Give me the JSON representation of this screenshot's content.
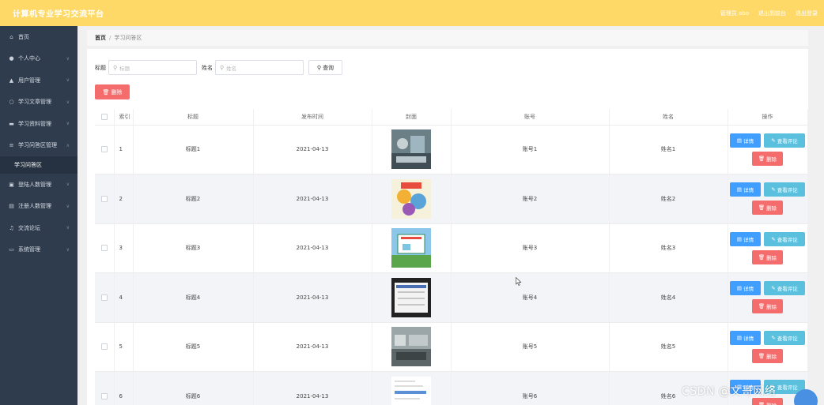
{
  "header": {
    "title": "计算机专业学习交流平台",
    "links": [
      "管理员 abo",
      "退出到前台",
      "退出登录"
    ]
  },
  "sidebar": {
    "items": [
      {
        "label": "首页",
        "icon": "home-icon",
        "chevron": false
      },
      {
        "label": "个人中心",
        "icon": "user-icon",
        "chevron": true
      },
      {
        "label": "用户管理",
        "icon": "users-icon",
        "chevron": true
      },
      {
        "label": "学习文章管理",
        "icon": "article-icon",
        "chevron": true
      },
      {
        "label": "学习资料管理",
        "icon": "file-icon",
        "chevron": true
      },
      {
        "label": "学习问答区管理",
        "icon": "menu-icon",
        "chevron": true,
        "expanded": true
      }
    ],
    "subitem": "学习问答区",
    "items_after": [
      {
        "label": "登陆人数管理",
        "icon": "clipboard-icon",
        "chevron": true
      },
      {
        "label": "注册人数管理",
        "icon": "list-icon",
        "chevron": true
      },
      {
        "label": "交流论坛",
        "icon": "forum-icon",
        "chevron": true
      },
      {
        "label": "系统管理",
        "icon": "settings-icon",
        "chevron": true
      }
    ]
  },
  "breadcrumb": {
    "home": "首页",
    "sep": "/",
    "current": "学习问答区"
  },
  "search": {
    "title_label": "标题",
    "title_placeholder": "标题",
    "name_label": "姓名",
    "name_placeholder": "姓名",
    "query_button": "查询"
  },
  "toolbar": {
    "delete_button": "删除"
  },
  "table": {
    "headers": [
      "",
      "索引",
      "标题",
      "发布时间",
      "封面",
      "账号",
      "姓名",
      "操作"
    ],
    "actions": {
      "detail": "详情",
      "comment": "查看评论",
      "delete": "删除"
    },
    "rows": [
      {
        "index": "1",
        "title": "标题1",
        "date": "2021-04-13",
        "account": "账号1",
        "name": "姓名1"
      },
      {
        "index": "2",
        "title": "标题2",
        "date": "2021-04-13",
        "account": "账号2",
        "name": "姓名2"
      },
      {
        "index": "3",
        "title": "标题3",
        "date": "2021-04-13",
        "account": "账号3",
        "name": "姓名3"
      },
      {
        "index": "4",
        "title": "标题4",
        "date": "2021-04-13",
        "account": "账号4",
        "name": "姓名4"
      },
      {
        "index": "5",
        "title": "标题5",
        "date": "2021-04-13",
        "account": "账号5",
        "name": "姓名5"
      },
      {
        "index": "6",
        "title": "标题6",
        "date": "2021-04-13",
        "account": "账号6",
        "name": "姓名6"
      }
    ]
  },
  "watermark": "CSDN @文哥网络",
  "colors": {
    "topbar": "#ffd967",
    "sidebar": "#2f3c4d",
    "primary": "#409eff",
    "info": "#5bc0de",
    "danger": "#f56c6c"
  }
}
